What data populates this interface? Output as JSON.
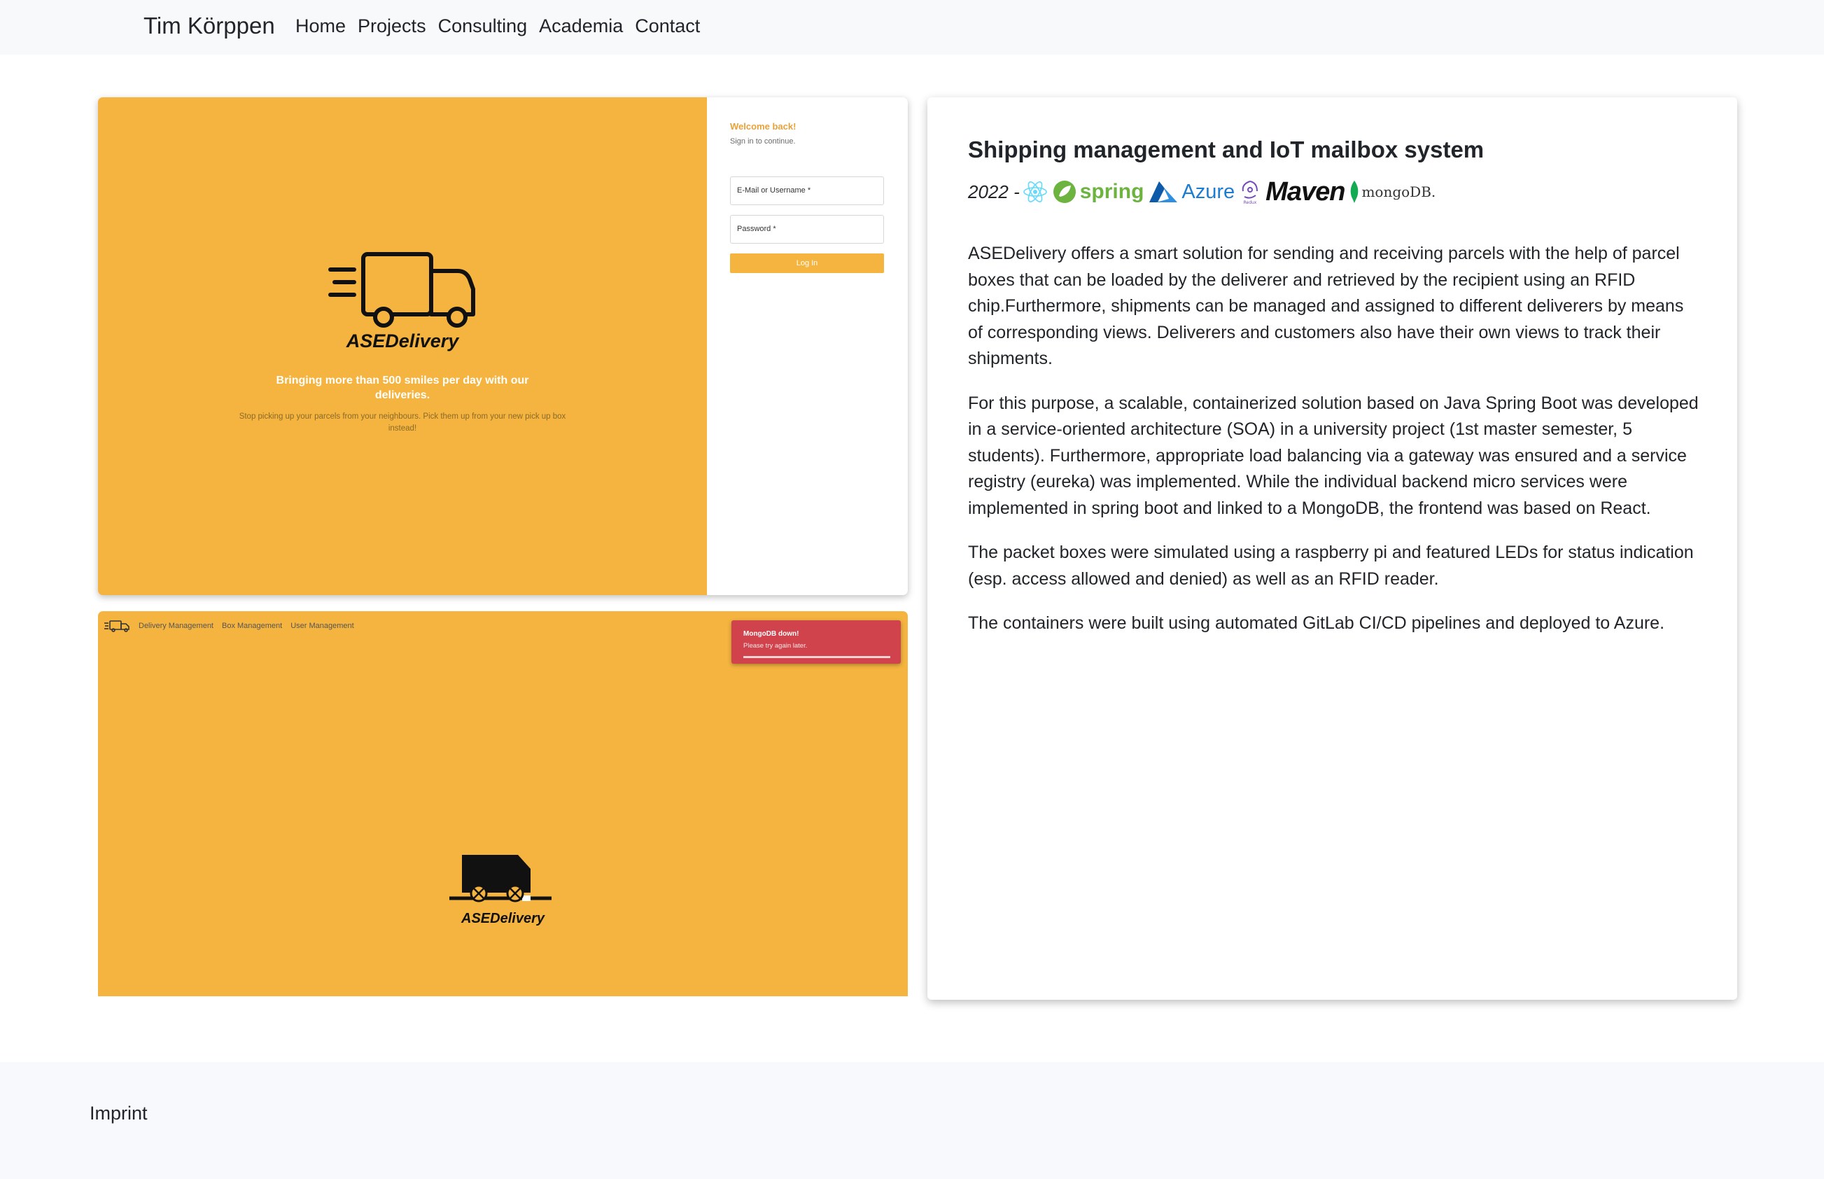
{
  "nav": {
    "brand": "Tim Körppen",
    "links": [
      {
        "label": "Home"
      },
      {
        "label": "Projects"
      },
      {
        "label": "Consulting"
      },
      {
        "label": "Academia"
      },
      {
        "label": "Contact"
      }
    ]
  },
  "screenshot_login": {
    "welcome": "Welcome back!",
    "subtitle": "Sign in to continue.",
    "email_placeholder": "E-Mail or Username *",
    "password_placeholder": "Password *",
    "login_button": "Log In",
    "app_name": "ASEDelivery",
    "tagline": "Bringing more than 500 smiles per day with our deliveries.",
    "tagline_sub": "Stop picking up your parcels from your neighbours. Pick them up from your new pick up box instead!"
  },
  "screenshot_error": {
    "nav_items": [
      "Delivery Management",
      "Box Management",
      "User Management"
    ],
    "toast_title": "MongoDB down!",
    "toast_message": "Please try again later.",
    "app_name": "ASEDelivery"
  },
  "project": {
    "title": "Shipping management and IoT mailbox system",
    "year": "2022 -",
    "tech_logos": [
      "react-icon",
      "spring-logo",
      "azure-logo",
      "redux-icon",
      "maven-logo",
      "mongodb-logo"
    ],
    "logo_text": {
      "spring": "spring",
      "azure": "Azure",
      "maven": "Maven",
      "mongodb": "mongoDB.",
      "redux": "Redux"
    },
    "paragraphs": [
      "ASEDelivery offers a smart solution for sending and receiving parcels with the help of parcel boxes that can be loaded by the deliverer and retrieved by the recipient using an RFID chip.Furthermore, shipments can be managed and assigned to different deliverers by means of corresponding views. Deliverers and customers also have their own views to track their shipments.",
      "For this purpose, a scalable, containerized solution based on Java Spring Boot was developed in a service-oriented architecture (SOA) in a university project (1st master semester, 5 students). Furthermore, appropriate load balancing via a gateway was ensured and a service registry (eureka) was implemented. While the individual backend micro services were implemented in spring boot and linked to a MongoDB, the frontend was based on React.",
      "The packet boxes were simulated using a raspberry pi and featured LEDs for status indication (esp. access allowed and denied) as well as an RFID reader.",
      "The containers were built using automated GitLab CI/CD pipelines and deployed to Azure."
    ]
  },
  "footer": {
    "imprint": "Imprint"
  },
  "colors": {
    "brand_yellow": "#f4b43f",
    "toast_red": "#d0434c",
    "navbar_bg": "#f8f9fa"
  }
}
